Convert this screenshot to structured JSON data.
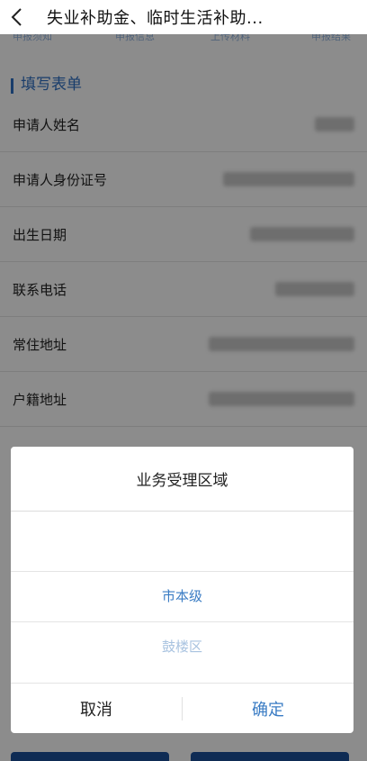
{
  "header": {
    "title": "失业补助金、临时生活补助..."
  },
  "steps": [
    "申报须知",
    "申报信息",
    "上传材料",
    "申报结果"
  ],
  "section": {
    "title": "填写表单"
  },
  "form": {
    "fields": [
      {
        "label": "申请人姓名"
      },
      {
        "label": "申请人身份证号"
      },
      {
        "label": "出生日期"
      },
      {
        "label": "联系电话"
      },
      {
        "label": "常住地址"
      },
      {
        "label": "户籍地址"
      }
    ]
  },
  "dialog": {
    "title": "业务受理区域",
    "options": [
      "市本级",
      "鼓楼区"
    ],
    "selected": "市本级",
    "cancel_label": "取消",
    "confirm_label": "确定"
  },
  "colors": {
    "accent": "#3a7cc4",
    "primary_dark": "#1a4f9a",
    "overlay": "#000000"
  }
}
